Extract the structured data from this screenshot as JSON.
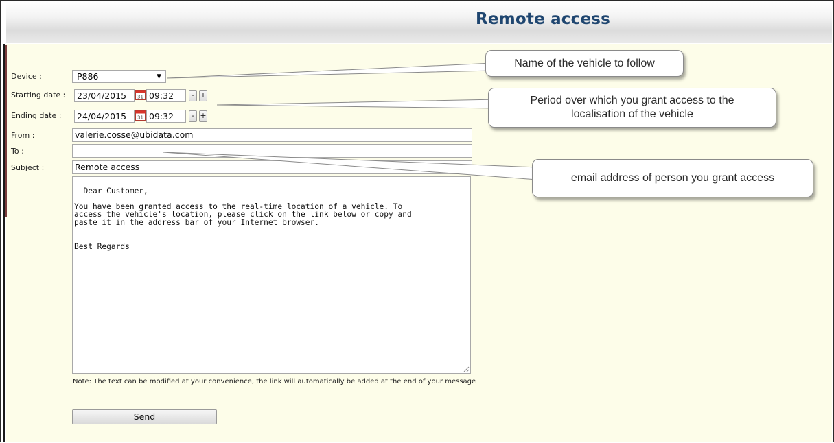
{
  "page": {
    "title": "Remote access"
  },
  "form": {
    "device": {
      "label": "Device :",
      "value": "P886"
    },
    "starting_date": {
      "label": "Starting date :",
      "date": "23/04/2015",
      "time": "09:32",
      "minus": "-",
      "plus": "+"
    },
    "ending_date": {
      "label": "Ending date :",
      "date": "24/04/2015",
      "time": "09:32",
      "minus": "-",
      "plus": "+"
    },
    "from": {
      "label": "From :",
      "value": "valerie.cosse@ubidata.com"
    },
    "to": {
      "label": "To :",
      "value": ""
    },
    "subject": {
      "label": "Subject :",
      "value": "Remote access"
    },
    "message": "Dear Customer,\n\nYou have been granted access to the real-time location of a vehicle. To\naccess the vehicle's location, please click on the link below or copy and\npaste it in the address bar of your Internet browser.\n\n\nBest Regards",
    "note": "Note: The text can be modified at your convenience, the link will automatically be added at the end of your message",
    "send_label": "Send"
  },
  "callouts": {
    "device": "Name of the vehicle to follow",
    "period": "Period over which you grant access to the localisation of the vehicle",
    "email": "email address of person you grant access"
  },
  "icons": {
    "calendar": "calendar-icon",
    "dropdown": "dropdown-arrow-icon",
    "resize": "resize-grip-icon"
  },
  "colors": {
    "title": "#1f4670",
    "content_background": "#fdfde9",
    "calendar_red": "#d9342b"
  }
}
